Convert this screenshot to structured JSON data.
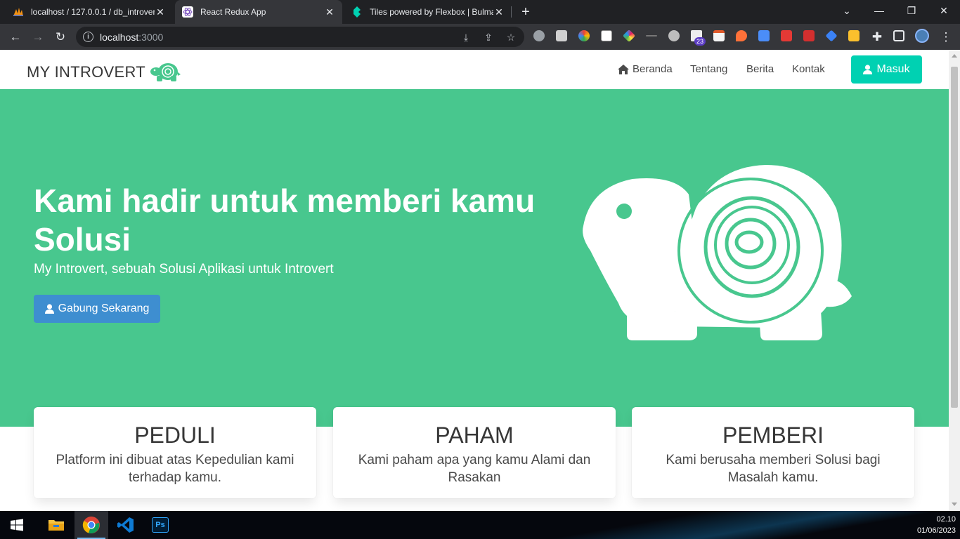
{
  "browser": {
    "tabs": [
      {
        "title": "localhost / 127.0.0.1 / db_introvert",
        "active": false
      },
      {
        "title": "React Redux App",
        "active": true
      },
      {
        "title": "Tiles powered by Flexbox | Bulma",
        "active": false
      }
    ],
    "url_host": "localhost",
    "url_port": ":3000"
  },
  "site": {
    "brand": "MY INTROVERT",
    "nav": {
      "home": "Beranda",
      "about": "Tentang",
      "news": "Berita",
      "contact": "Kontak",
      "login": "Masuk"
    },
    "hero": {
      "title": "Kami hadir untuk memberi kamu Solusi",
      "subtitle": "My Introvert, sebuah Solusi Aplikasi untuk Introvert",
      "cta": "Gabung Sekarang"
    },
    "cards": [
      {
        "title": "PEDULI",
        "text": "Platform ini dibuat atas Kepedulian kami terhadap kamu."
      },
      {
        "title": "PAHAM",
        "text": "Kami paham apa yang kamu Alami dan Rasakan"
      },
      {
        "title": "PEMBERI",
        "text": "Kami berusaha memberi Solusi bagi Masalah kamu."
      }
    ]
  },
  "colors": {
    "hero": "#48c78e",
    "login_button": "#00d1b2",
    "cta_button": "#3e8ed0"
  },
  "extensions": {
    "badge_count": "23"
  },
  "taskbar": {
    "time": "02.10",
    "date": "01/06/2023",
    "photoshop_label": "Ps"
  }
}
